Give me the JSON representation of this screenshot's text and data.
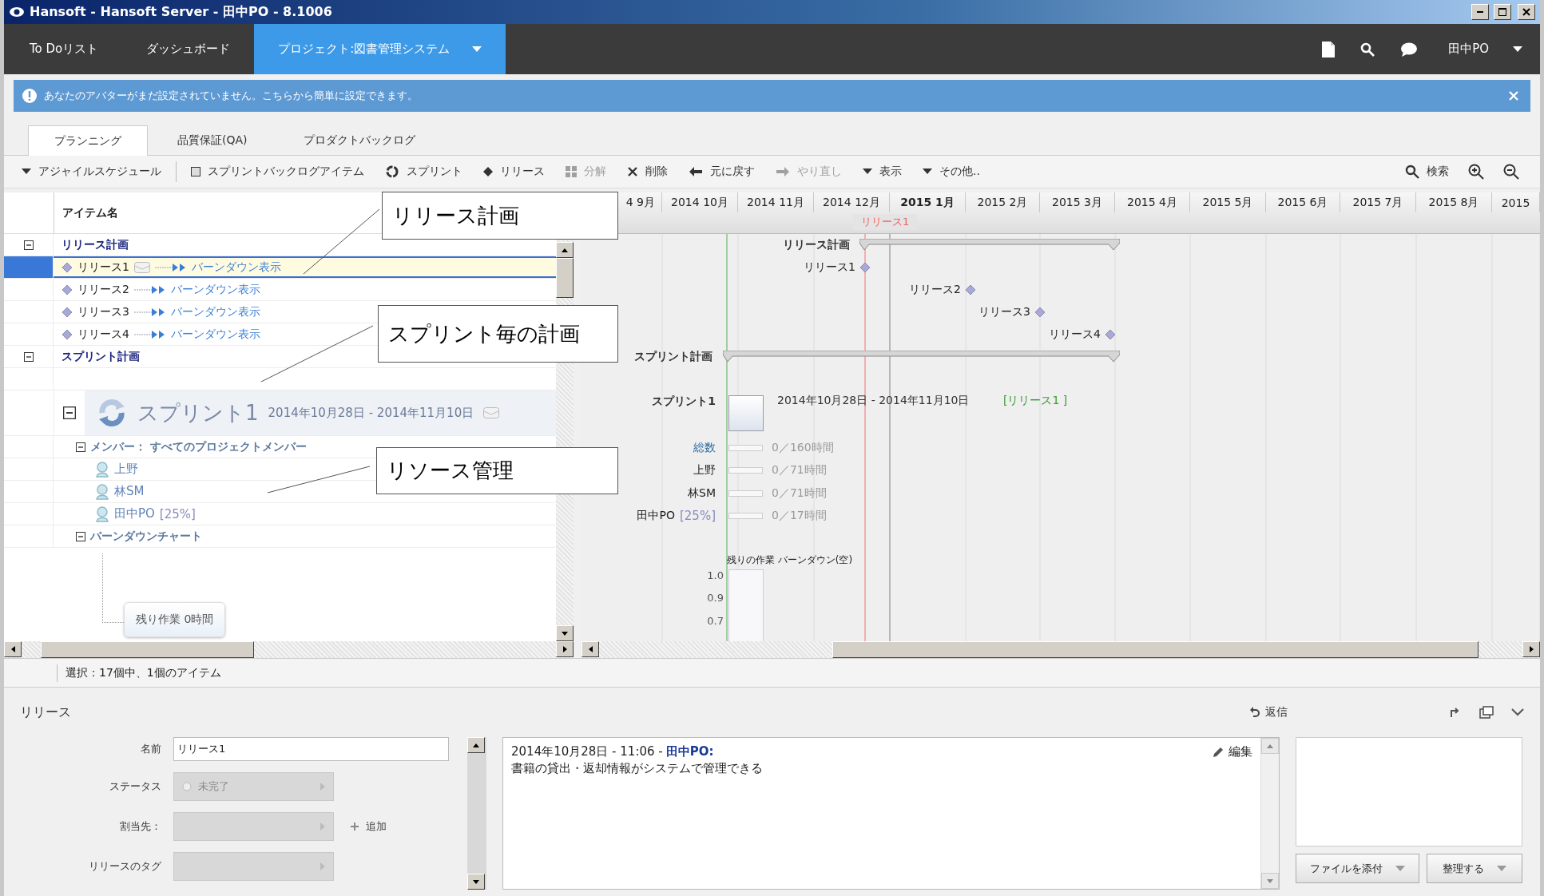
{
  "window": {
    "title": "Hansoft - Hansoft Server - 田中PO - 8.1006"
  },
  "nav": {
    "items": [
      {
        "label": "To Doリスト",
        "selected": false
      },
      {
        "label": "ダッシュボード",
        "selected": false
      },
      {
        "label": "プロジェクト:図書管理システム",
        "selected": true
      }
    ],
    "user": "田中PO"
  },
  "notice": {
    "text": "あなたのアバターがまだ設定されていません。こちらから簡単に設定できます。"
  },
  "tabs": [
    {
      "label": "プランニング",
      "selected": true
    },
    {
      "label": "品質保証(QA)",
      "selected": false
    },
    {
      "label": "プロダクトバックログ",
      "selected": false
    }
  ],
  "toolbar": {
    "items": [
      {
        "label": "アジャイルスケジュール",
        "kind": "dropdown",
        "disabled": false
      },
      {
        "label": "スプリントバックログアイテム",
        "kind": "item",
        "disabled": false
      },
      {
        "label": "スプリント",
        "kind": "sprint",
        "disabled": false
      },
      {
        "label": "リリース",
        "kind": "release",
        "disabled": false
      },
      {
        "label": "分解",
        "kind": "split",
        "disabled": true
      },
      {
        "label": "削除",
        "kind": "delete",
        "disabled": false
      },
      {
        "label": "元に戻す",
        "kind": "undo",
        "disabled": false
      },
      {
        "label": "やり直し",
        "kind": "redo",
        "disabled": true
      },
      {
        "label": "表示",
        "kind": "dropdown",
        "disabled": false
      },
      {
        "label": "その他..",
        "kind": "dropdown",
        "disabled": false
      }
    ],
    "right": [
      {
        "label": "検索",
        "kind": "search"
      },
      {
        "kind": "zoom-in"
      },
      {
        "kind": "zoom-out"
      }
    ]
  },
  "tree": {
    "header": "アイテム名",
    "groups": [
      {
        "label": "リリース計画",
        "expanded": true,
        "children": [
          {
            "kind": "release",
            "label": "リリース1",
            "link": "バーンダウン表示",
            "selected": true,
            "has_note": true
          },
          {
            "kind": "release",
            "label": "リリース2",
            "link": "バーンダウン表示",
            "selected": false,
            "has_note": false
          },
          {
            "kind": "release",
            "label": "リリース3",
            "link": "バーンダウン表示",
            "selected": false,
            "has_note": false
          },
          {
            "kind": "release",
            "label": "リリース4",
            "link": "バーンダウン表示",
            "selected": false,
            "has_note": false
          }
        ]
      },
      {
        "label": "スプリント計画",
        "expanded": true,
        "children": [
          {
            "kind": "sprint",
            "name": "スプリント1",
            "dates": "2014年10月28日 - 2014年11月10日",
            "has_note": true,
            "expanded": true,
            "children": [
              {
                "kind": "members",
                "label": "メンバー： すべてのプロジェクトメンバー",
                "expanded": true,
                "children": [
                  {
                    "name": "上野"
                  },
                  {
                    "name": "林SM"
                  },
                  {
                    "name": "田中PO",
                    "share": "[25%]"
                  }
                ]
              },
              {
                "kind": "burndown",
                "label": "バーンダウンチャート",
                "expanded": true,
                "note": "残り作業 0時間"
              }
            ]
          }
        ]
      }
    ]
  },
  "gantt": {
    "months": [
      {
        "label": "4 9月",
        "current": false
      },
      {
        "label": "2014 10月",
        "current": false
      },
      {
        "label": "2014 11月",
        "current": false
      },
      {
        "label": "2014 12月",
        "current": false
      },
      {
        "label": "2015 1月",
        "current": true
      },
      {
        "label": "2015 2月",
        "current": false
      },
      {
        "label": "2015 3月",
        "current": false
      },
      {
        "label": "2015 4月",
        "current": false
      },
      {
        "label": "2015 5月",
        "current": false
      },
      {
        "label": "2015 6月",
        "current": false
      },
      {
        "label": "2015 7月",
        "current": false
      },
      {
        "label": "2015 8月",
        "current": false
      },
      {
        "label": "2015",
        "current": false
      }
    ],
    "marker": "リリース1",
    "summaries": [
      {
        "label": "リリース計画"
      },
      {
        "label": "スプリント計画"
      }
    ],
    "milestones": [
      {
        "label": "リリース1"
      },
      {
        "label": "リリース2"
      },
      {
        "label": "リリース3"
      },
      {
        "label": "リリース4"
      }
    ],
    "sprint": {
      "label": "スプリント1",
      "dates": "2014年10月28日 - 2014年11月10日",
      "release": "[リリース1 ]"
    },
    "resources": [
      {
        "kind": "total",
        "name": "総数",
        "hours": "0／160時間",
        "level": 0
      },
      {
        "kind": "member",
        "name": "上野",
        "hours": "0／71時間",
        "level": 0
      },
      {
        "kind": "member",
        "name": "林SM",
        "hours": "0／71時間",
        "level": 0
      },
      {
        "kind": "member",
        "name": "田中PO",
        "share": "[25%]",
        "hours": "0／17時間",
        "level": 0
      }
    ],
    "burndown": {
      "title": "残りの作業 バーンダウン(空)",
      "ticks": [
        "1.0",
        "0.9",
        "0.7"
      ]
    }
  },
  "status_bar": "選択：17個中、1個のアイテム",
  "detail": {
    "title": "リリース",
    "reply": "返信",
    "fields": [
      {
        "label": "名前",
        "kind": "text",
        "value": "リリース1"
      },
      {
        "label": "ステータス",
        "kind": "select",
        "value": "未完了"
      },
      {
        "label": "割当先：",
        "kind": "select",
        "action": "追加"
      },
      {
        "label": "リリースのタグ",
        "kind": "select"
      }
    ],
    "comment": {
      "meta": "2014年10月28日 - 11:06 -",
      "author": "田中PO:",
      "body": "書籍の貸出・返却情報がシステムで管理できる",
      "edit": "編集"
    },
    "buttons": [
      "ファイルを添付",
      "整理する"
    ]
  },
  "callouts": [
    "リリース計画",
    "スプリント毎の計画",
    "リソース管理"
  ]
}
